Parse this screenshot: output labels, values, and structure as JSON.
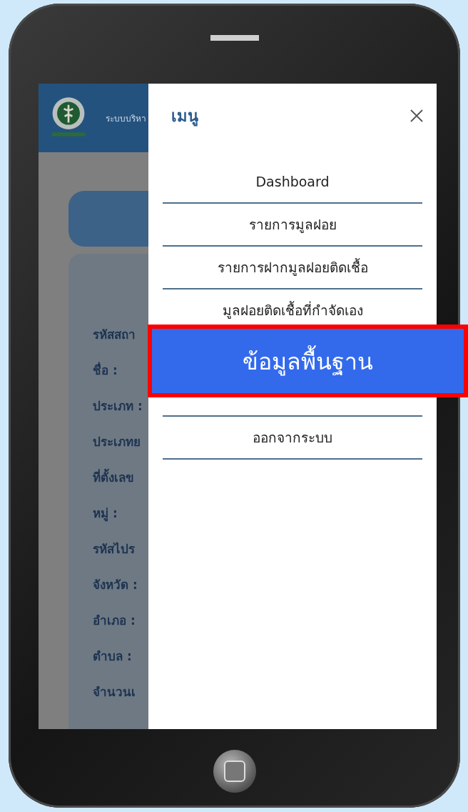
{
  "app": {
    "header_title": "ระบบบริหา",
    "fields": [
      "รหัสสถา",
      "ชื่อ :",
      "ประเภท :",
      "ประเภทย",
      "ที่ตั้งเลข",
      "หมู่ :",
      "รหัสไปร",
      "จังหวัด :",
      "อำเภอ :",
      "ตำบล :",
      "จำนวนเ"
    ]
  },
  "menu": {
    "title": "เมนู",
    "items": [
      {
        "label": "Dashboard"
      },
      {
        "label": "รายการมูลฝอย"
      },
      {
        "label": "รายการฝากมูลฝอยติดเชื้อ"
      },
      {
        "label": "มูลฝอยติดเชื้อที่กำจัดเอง"
      },
      {
        "label": "ออกจากระบบ"
      }
    ]
  },
  "callout": {
    "label": "ข้อมูลพื้นฐาน"
  }
}
